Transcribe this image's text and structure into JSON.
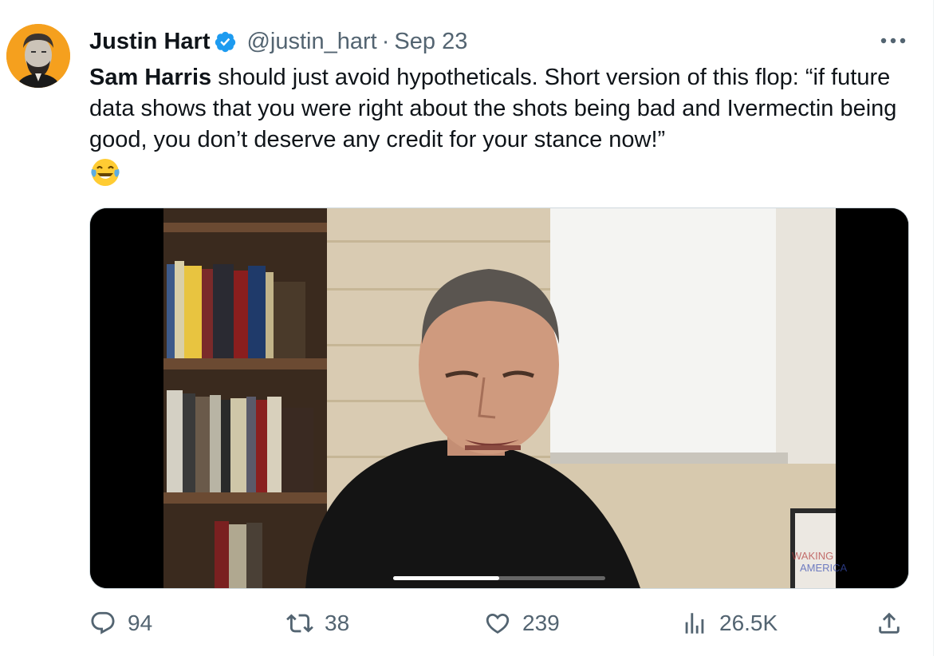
{
  "author": {
    "display_name": "Justin Hart",
    "handle": "@justin_hart",
    "separator": "·",
    "date": "Sep 23",
    "verified": true,
    "avatar_bg": "#f5a01e"
  },
  "tweet": {
    "mention": "Sam Harris",
    "text": " should just avoid hypotheticals. Short version of this flop: “if future data shows that you were right about the shots being bad and Ivermectin being good, you don’t deserve any credit for your stance now!”",
    "emoji": "face-with-tears-of-joy"
  },
  "media": {
    "type": "video",
    "progress": 0.5
  },
  "actions": {
    "replies": "94",
    "reposts": "38",
    "likes": "239",
    "views": "26.5K"
  },
  "colors": {
    "text": "#0f1419",
    "secondary": "#536471",
    "verified": "#1d9bf0",
    "border": "#cfd9de"
  }
}
